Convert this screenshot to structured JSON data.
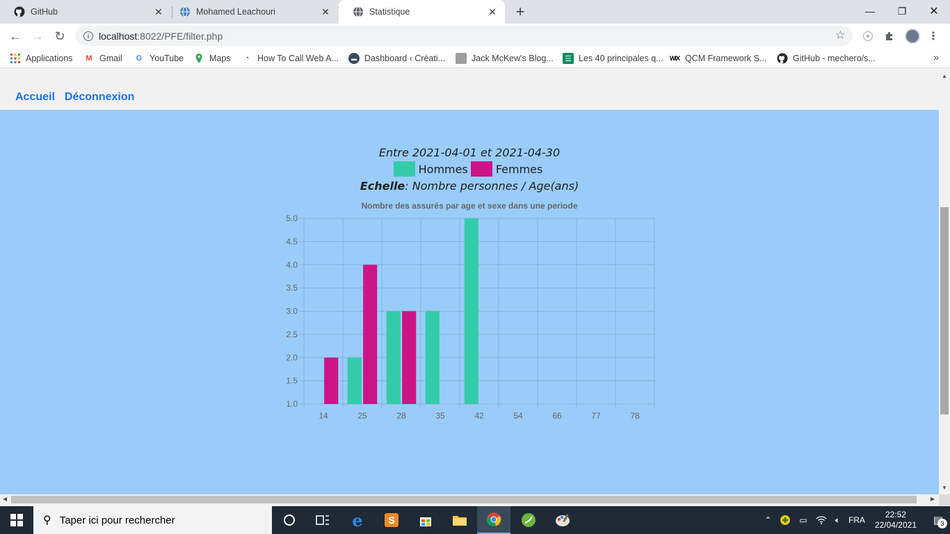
{
  "browser": {
    "tabs": [
      {
        "title": "GitHub",
        "icon": "github-icon"
      },
      {
        "title": "Mohamed Leachouri",
        "icon": "globe-icon"
      },
      {
        "title": "Statistique",
        "icon": "globe-icon",
        "active": true
      }
    ],
    "url_host": "localhost",
    "url_path": ":8022/PFE/filter.php"
  },
  "bookmarks": [
    {
      "label": "Applications",
      "icon": "apps-grid-icon"
    },
    {
      "label": "Gmail",
      "icon": "gmail-icon"
    },
    {
      "label": "YouTube",
      "icon": "google-icon"
    },
    {
      "label": "Maps",
      "icon": "maps-icon"
    },
    {
      "label": "How To Call Web A...",
      "icon": "web-icon"
    },
    {
      "label": "Dashboard ‹ Créati...",
      "icon": "dashboard-icon"
    },
    {
      "label": "Jack McKew's Blog...",
      "icon": "blog-icon"
    },
    {
      "label": "Les 40 principales q...",
      "icon": "list-icon"
    },
    {
      "label": "QCM Framework S...",
      "icon": "wix-icon"
    },
    {
      "label": "GitHub - mechero/s...",
      "icon": "github-icon"
    }
  ],
  "page": {
    "nav": {
      "home": "Accueil",
      "logout": "Déconnexion"
    },
    "period": "Entre 2021-04-01 et 2021-04-30",
    "legend": {
      "men": "Hommes",
      "women": "Femmes"
    },
    "scale_label": "Echelle",
    "scale_text": ": Nombre personnes / Age(ans)"
  },
  "colors": {
    "men": "#33cca8",
    "women": "#cc1486",
    "panel": "#99ccf9"
  },
  "chart_data": {
    "type": "bar",
    "title": "Nombre des assurés par age et sexe dans une periode",
    "categories": [
      "14",
      "25",
      "28",
      "35",
      "42",
      "54",
      "66",
      "77",
      "78"
    ],
    "series": [
      {
        "name": "Hommes",
        "color": "#33cca8",
        "values": [
          null,
          2,
          3,
          3,
          5,
          null,
          null,
          null,
          null
        ]
      },
      {
        "name": "Femmes",
        "color": "#cc1486",
        "values": [
          2,
          4,
          3,
          null,
          null,
          null,
          null,
          null,
          null
        ]
      }
    ],
    "ylim": [
      1.0,
      5.0
    ],
    "yticks": [
      "5.0",
      "4.5",
      "4.0",
      "3.5",
      "3.0",
      "2.5",
      "2.0",
      "1.5",
      "1.0"
    ],
    "grid": true
  },
  "taskbar": {
    "search_placeholder": "Taper ici pour rechercher",
    "language": "FRA",
    "time": "22:52",
    "date": "22/04/2021",
    "notifications": "3"
  }
}
